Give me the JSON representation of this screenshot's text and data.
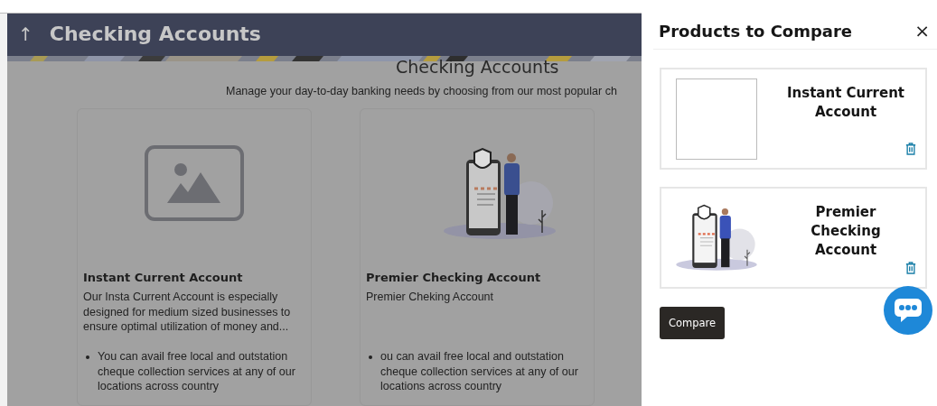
{
  "header": {
    "back_icon": "↑",
    "title": "Checking Accounts"
  },
  "page": {
    "heading": "Checking Accounts",
    "subheading": "Manage your day-to-day banking needs by choosing from our most popular ch"
  },
  "products": [
    {
      "kind": "placeholder",
      "name": "Instant Current Account",
      "description": "Our Insta Current Account is especially designed for medium sized businesses to ensure optimal utilization of money and...",
      "features": [
        "You can avail free local and outstation cheque collection services at any of our locations across country"
      ]
    },
    {
      "kind": "illustration",
      "name": "Premier Checking Account",
      "description": "Premier Cheking Account",
      "features": [
        "ou can avail free local and outstation cheque collection services at any of our locations across country"
      ]
    }
  ],
  "compare_panel": {
    "title": "Products to Compare",
    "close": "×",
    "items": [
      {
        "kind": "blank",
        "name": "Instant Current Account"
      },
      {
        "kind": "illustration",
        "name": "Premier Checking Account"
      }
    ],
    "compare_button": "Compare"
  }
}
